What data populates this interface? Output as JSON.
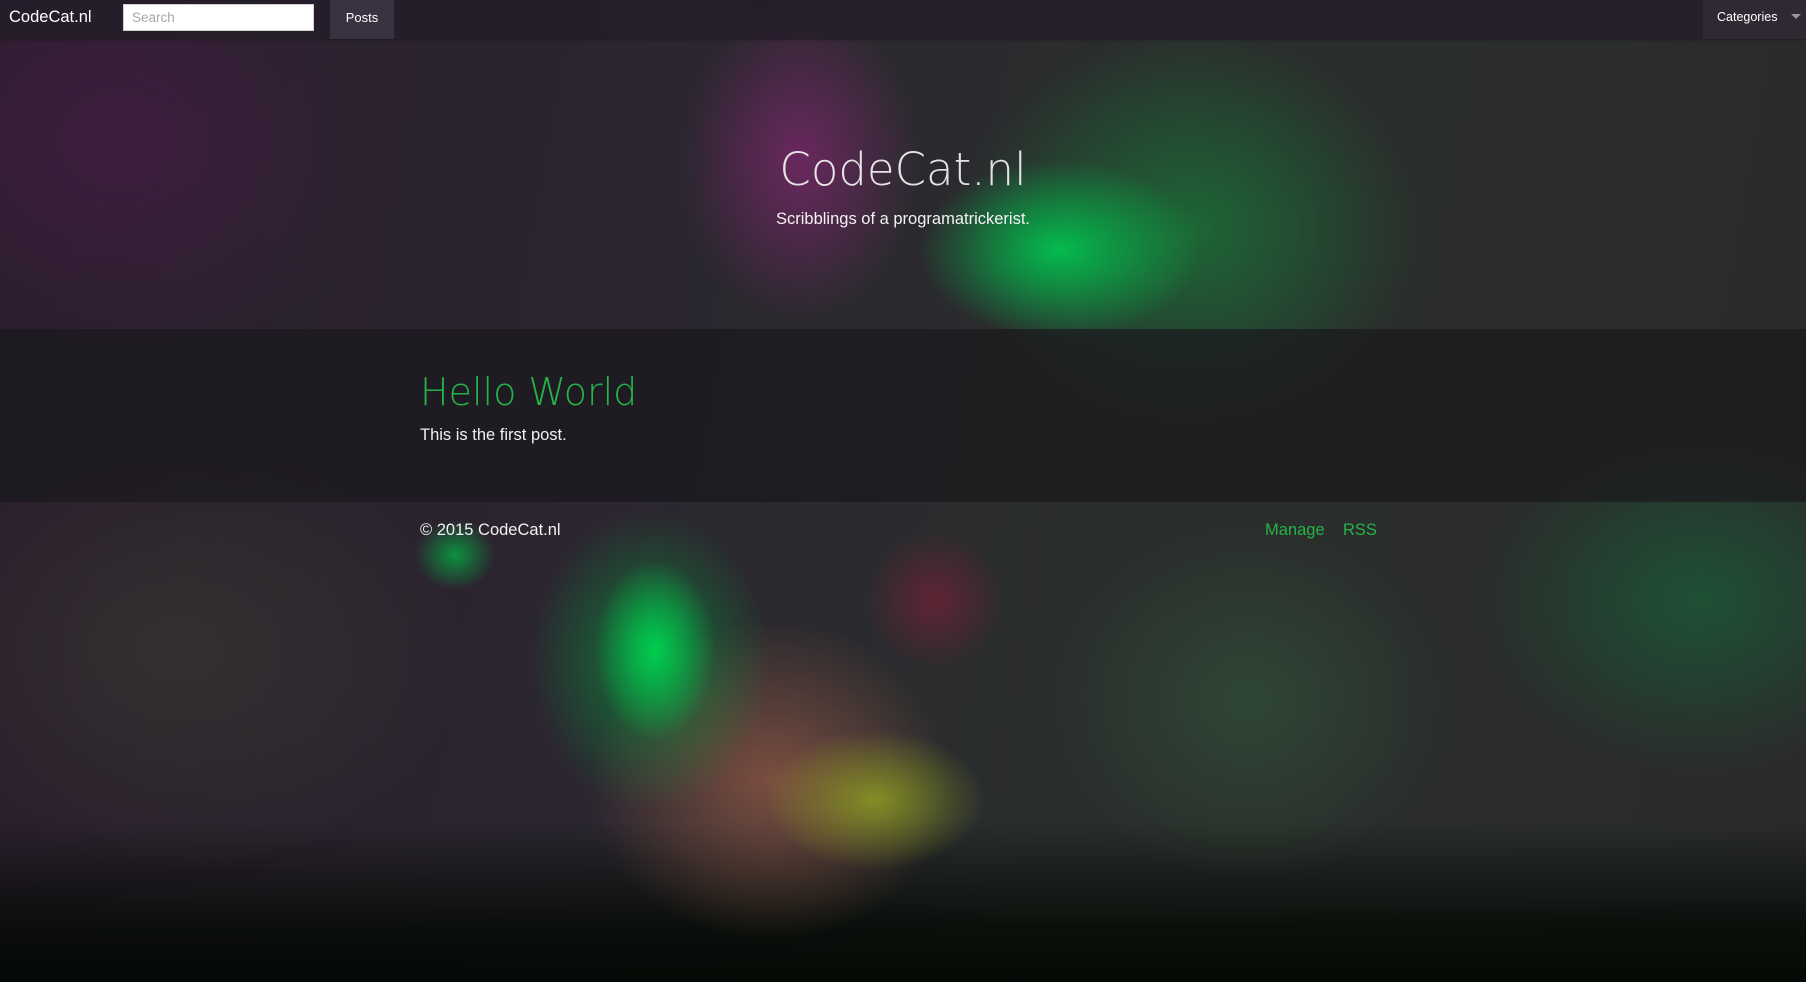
{
  "navbar": {
    "brand": "CodeCat.nl",
    "search_placeholder": "Search",
    "posts_label": "Posts",
    "categories_label": "Categories"
  },
  "hero": {
    "title": "CodeCat.nl",
    "subtitle": "Scribblings of a programatrickerist."
  },
  "post": {
    "title": "Hello World",
    "body": "This is the first post."
  },
  "footer": {
    "copyright": "© 2015 CodeCat.nl",
    "links": [
      "Manage",
      "RSS"
    ]
  },
  "colors": {
    "accent_green": "#25b347",
    "navbar_bg": "#241e2a",
    "active_nav_bg": "#3a3240"
  }
}
